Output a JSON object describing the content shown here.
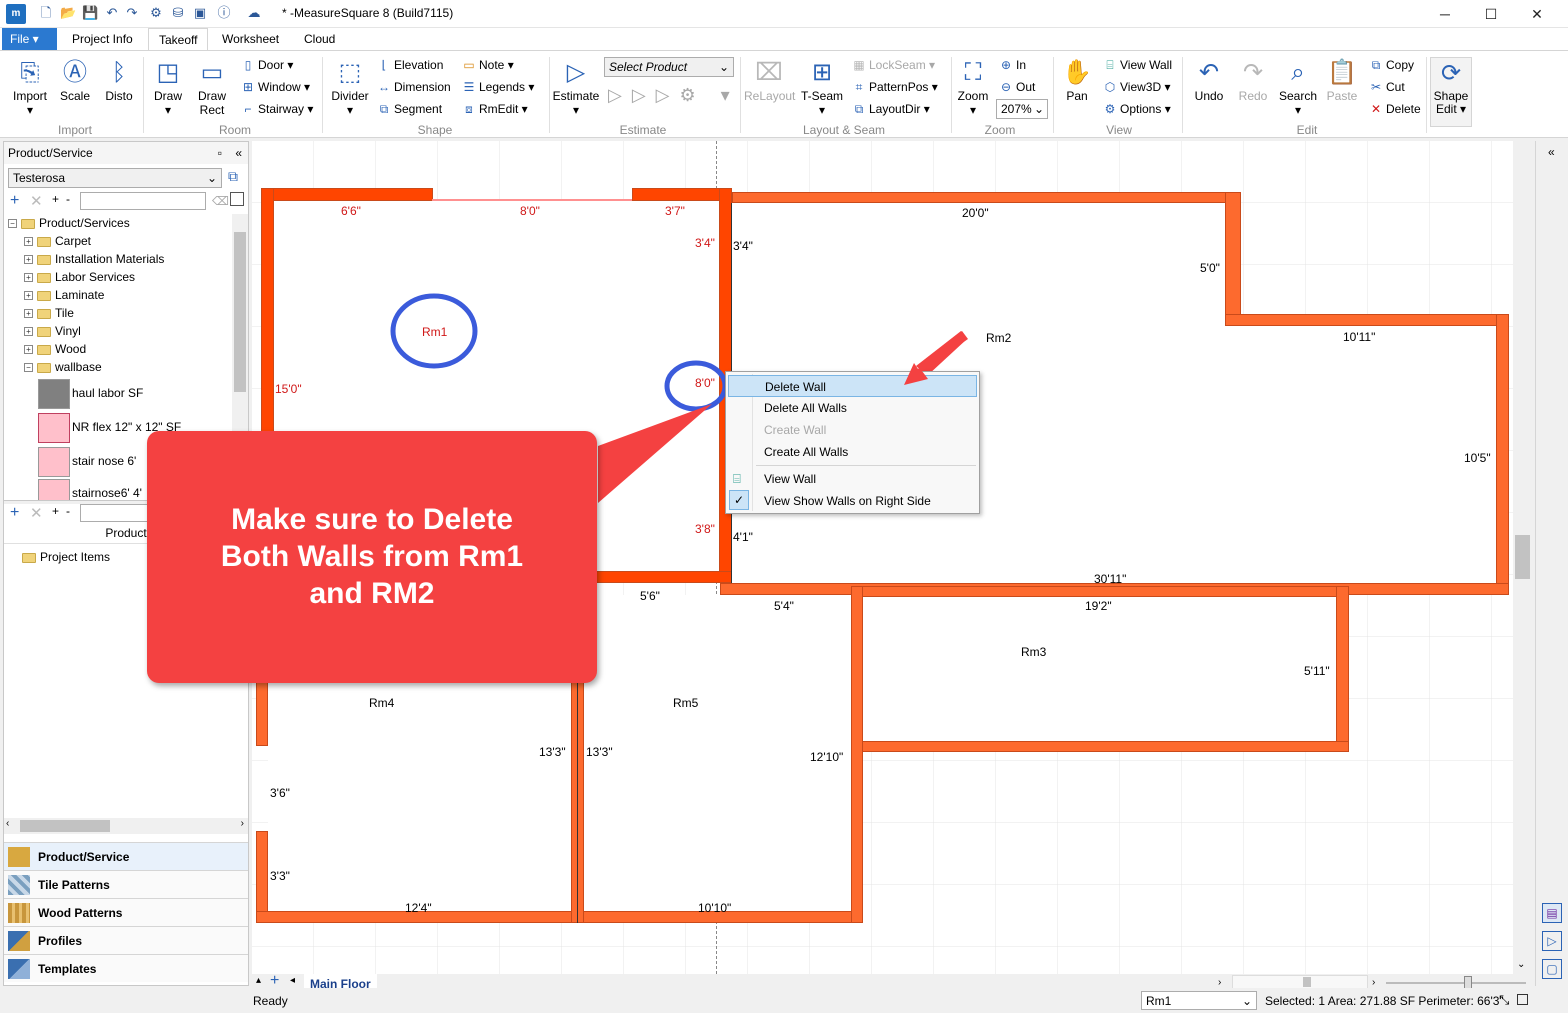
{
  "titlebar": {
    "logo": "m",
    "title": "* -MeasureSquare 8 (Build7115)",
    "minimize": "─",
    "maximize": "☐",
    "close": "✕"
  },
  "tabs": [
    "File",
    "Project Info",
    "Takeoff",
    "Worksheet",
    "Cloud"
  ],
  "ribbon": {
    "import": {
      "import": "Import",
      "scale": "Scale",
      "disto": "Disto",
      "group": "Import"
    },
    "room": {
      "draw": "Draw",
      "draw_rect": "Draw Rect",
      "door": "Door",
      "window": "Window",
      "stairway": "Stairway",
      "group": "Room"
    },
    "shape": {
      "divider": "Divider",
      "elevation": "Elevation",
      "dimension": "Dimension",
      "segment": "Segment",
      "note": "Note",
      "legends": "Legends",
      "rmedit": "RmEdit",
      "group": "Shape"
    },
    "estimate": {
      "estimate": "Estimate",
      "select_product": "Select Product",
      "group": "Estimate"
    },
    "layout": {
      "relayout": "ReLayout",
      "tseam": "T-Seam",
      "lockseam": "LockSeam",
      "patternpos": "PatternPos",
      "layoutdir": "LayoutDir",
      "group": "Layout & Seam"
    },
    "zoom": {
      "zoom": "Zoom",
      "in": "In",
      "out": "Out",
      "level": "207%",
      "group": "Zoom"
    },
    "view": {
      "pan": "Pan",
      "view_wall": "View Wall",
      "view3d": "View3D",
      "options": "Options",
      "group": "View"
    },
    "edit": {
      "undo": "Undo",
      "redo": "Redo",
      "search": "Search",
      "paste": "Paste",
      "copy": "Copy",
      "cut": "Cut",
      "delete": "Delete",
      "group": "Edit"
    },
    "shape_edit": "Shape Edit"
  },
  "left": {
    "header": "Product/Service",
    "vendor": "Testerosa",
    "tree_root": "Product/Services",
    "categories": [
      "Carpet",
      "Installation Materials",
      "Labor Services",
      "Laminate",
      "Tile",
      "Vinyl",
      "Wood",
      "wallbase"
    ],
    "products": [
      {
        "name": "haul labor  SF",
        "color": "#808080"
      },
      {
        "name": "NR flex 12\" x 12\" SF",
        "color": "#ffc0cb"
      },
      {
        "name": "stair nose 6'",
        "color": "#ffc0cb"
      },
      {
        "name": "stairnose6' 4'",
        "color": "#ffc0cb"
      }
    ],
    "product_col": "Product",
    "project_items": "Project Items",
    "nav": [
      "Product/Service",
      "Tile Patterns",
      "Wood Patterns",
      "Profiles",
      "Templates"
    ]
  },
  "rooms": {
    "rm1": "Rm1",
    "rm2": "Rm2",
    "rm3": "Rm3",
    "rm4": "Rm4",
    "rm5": "Rm5"
  },
  "dims": {
    "rm1_top_a": "6'6\"",
    "rm1_top_b": "8'0\"",
    "rm1_top_c": "3'7\"",
    "rm1_r1": "3'4\"",
    "rm1_left": "15'0\"",
    "rm1_r2": "8'0\"",
    "rm1_r3": "3'8\"",
    "rm2_top": "20'0\"",
    "rm2_l1": "3'4\"",
    "rm2_step": "5'0\"",
    "rm2_top2": "10'11\"",
    "rm2_right": "10'5\"",
    "rm2_l2": "4'1\"",
    "rm2_bottom": "30'11\"",
    "rm3_top": "19'2\"",
    "rm3_right": "5'11\"",
    "rm5_top": "5'4\"",
    "rm4_top": "5'6\"",
    "rm4_right": "13'3\"",
    "rm5_left": "13'3\"",
    "rm5_right": "12'10\"",
    "rm4_left1": "3'6\"",
    "rm4_left2": "3'3\"",
    "rm4_bottom": "12'4\"",
    "rm5_bottom": "10'10\""
  },
  "context_menu": [
    "Delete Wall",
    "Delete All Walls",
    "Create Wall",
    "Create All Walls",
    "View Wall",
    "View Show Walls on Right Side"
  ],
  "callout": {
    "line1": "Make sure to Delete",
    "line2": "Both Walls from Rm1",
    "line3": "and RM2"
  },
  "sheet_tab": "Main Floor",
  "status": {
    "ready": "Ready",
    "room_select": "Rm1",
    "info": "Selected: 1 Area: 271.88 SF Perimeter: 66'3\""
  },
  "colors": {
    "wall": "#fd6a2e",
    "callout": "#f44141",
    "highlight": "#3b5bdb",
    "accent": "#2b79d0"
  }
}
